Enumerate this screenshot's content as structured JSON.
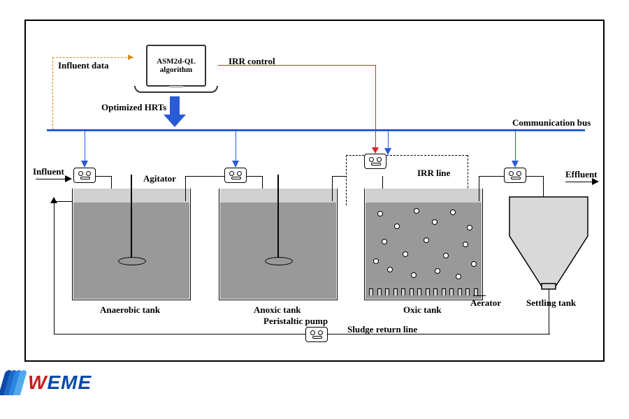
{
  "controller": {
    "screen_text": "ASM2d-QL algorithm",
    "input_label": "Influent data",
    "output_down": "Optimized HRTs",
    "output_right": "IRR control"
  },
  "bus": {
    "label": "Communication bus"
  },
  "flow": {
    "influent": "Influent",
    "effluent": "Effluent",
    "sludge_return": "Sludge return line",
    "irr_line": "IRR line",
    "peristaltic_pump": "Peristaltic pump"
  },
  "tanks": {
    "anaerobic": {
      "label": "Anaerobic tank",
      "agitator_label": "Agitator"
    },
    "anoxic": {
      "label": "Anoxic tank"
    },
    "oxic": {
      "label": "Oxic tank",
      "aerator_label": "Aerator"
    },
    "settler": {
      "label": "Settling tank"
    }
  },
  "logo": {
    "text": "WEME"
  },
  "colors": {
    "bus": "#2a5bd7",
    "irr": "#d62424",
    "influent_data": "#d98b1a",
    "tank_fill": "#999999",
    "wave_blue_dark": "#0a4aa8",
    "wave_blue_light": "#2a86e0",
    "logo_red": "#cc1a1a"
  }
}
